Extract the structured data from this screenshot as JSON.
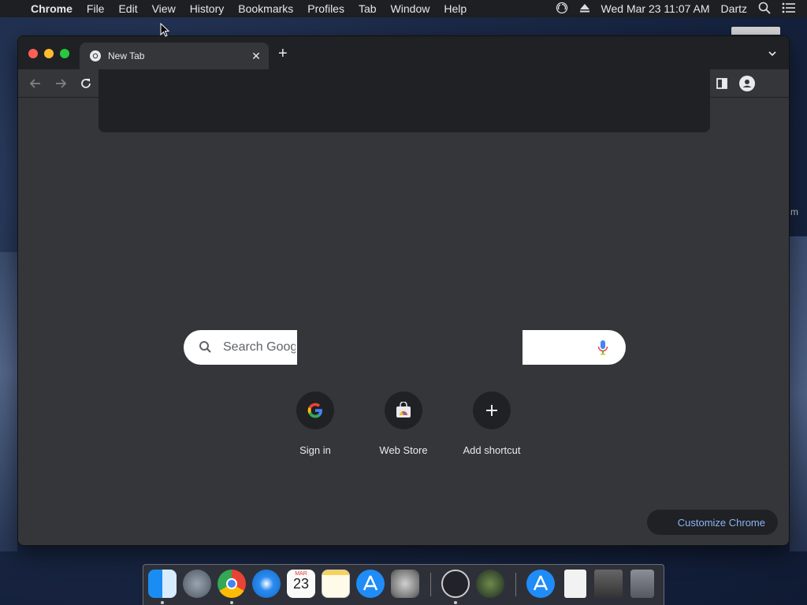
{
  "menubar": {
    "app_name": "Chrome",
    "menus": [
      "File",
      "Edit",
      "View",
      "History",
      "Bookmarks",
      "Profiles",
      "Tab",
      "Window",
      "Help"
    ],
    "clock": "Wed Mar 23  11:07 AM",
    "user": "Dartz",
    "icons": [
      "apple-icon",
      "obs-status-icon",
      "eject-icon",
      "spotlight-search-icon",
      "control-center-icon"
    ]
  },
  "browser": {
    "tab_title": "New Tab",
    "tab_favicon": "chrome-icon",
    "toolbar_icons": [
      "back-icon",
      "forward-icon",
      "reload-icon",
      "side-panel-icon",
      "profile-icon"
    ]
  },
  "ntp": {
    "search_placeholder": "Search Goog",
    "shortcuts": [
      {
        "label": "Sign in",
        "icon": "google-g-icon"
      },
      {
        "label": "Web Store",
        "icon": "web-store-icon"
      },
      {
        "label": "Add shortcut",
        "icon": "plus-icon"
      }
    ],
    "customize_label": "Customize Chrome"
  },
  "desktop": {
    "edge_text": "m"
  },
  "dock": {
    "apps": [
      "Finder",
      "Launchpad",
      "Google Chrome",
      "Safari",
      "Calendar",
      "Notes",
      "App Store",
      "System Preferences",
      "OBS",
      "Steam Client",
      "App Store Installer",
      "Preview",
      "Disk Image",
      "Trash"
    ],
    "calendar_month": "MAR",
    "calendar_day": "23"
  },
  "colors": {
    "window_bg": "#35363a",
    "tabstrip_bg": "#202124",
    "accent_link": "#8ab4f8",
    "text": "#e8eaed"
  }
}
